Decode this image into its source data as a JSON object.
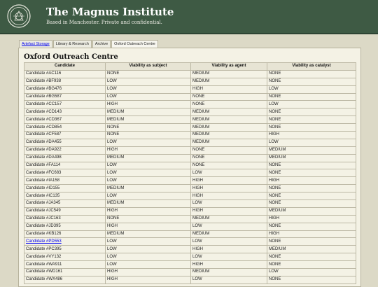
{
  "header": {
    "title": "The Magnus Institute",
    "tagline": "Based in Manchester. Private and confidential."
  },
  "tabs": [
    {
      "label": "Artefact Storage",
      "link": true
    },
    {
      "label": "Library & Research",
      "link": false
    },
    {
      "label": "Archive",
      "link": false
    },
    {
      "label": "Oxford Outreach Centre",
      "link": false,
      "active": true
    }
  ],
  "page": {
    "title": "Oxford Outreach Centre"
  },
  "table": {
    "columns": [
      "Candidate",
      "Viability as subject",
      "Viability as agent",
      "Viability as catalyst"
    ],
    "rows": [
      [
        "Candidate #AC116",
        "NONE",
        "MEDIUM",
        "NONE"
      ],
      [
        "Candidate #BF938",
        "LOW",
        "MEDIUM",
        "NONE"
      ],
      [
        "Candidate #BG476",
        "LOW",
        "HIGH",
        "LOW"
      ],
      [
        "Candidate #BG587",
        "LOW",
        "NONE",
        "NONE"
      ],
      [
        "Candidate #CC157",
        "HIGH",
        "NONE",
        "LOW"
      ],
      [
        "Candidate #CD143",
        "MEDIUM",
        "MEDIUM",
        "NONE"
      ],
      [
        "Candidate #CD367",
        "MEDIUM",
        "MEDIUM",
        "NONE"
      ],
      [
        "Candidate #CD854",
        "NONE",
        "MEDIUM",
        "NONE"
      ],
      [
        "Candidate #CF587",
        "NONE",
        "MEDIUM",
        "HIGH"
      ],
      [
        "Candidate #DA455",
        "LOW",
        "MEDIUM",
        "LOW"
      ],
      [
        "Candidate #DA922",
        "HIGH",
        "NONE",
        "MEDIUM"
      ],
      [
        "Candidate #DA498",
        "MEDIUM",
        "NONE",
        "MEDIUM"
      ],
      [
        "Candidate #FA114",
        "LOW",
        "NONE",
        "NONE"
      ],
      [
        "Candidate #FC683",
        "LOW",
        "LOW",
        "NONE"
      ],
      [
        "Candidate #IA158",
        "LOW",
        "HIGH",
        "HIGH"
      ],
      [
        "Candidate #ID155",
        "MEDIUM",
        "HIGH",
        "NONE"
      ],
      [
        "Candidate #IC135",
        "LOW",
        "HIGH",
        "NONE"
      ],
      [
        "Candidate #JA345",
        "MEDIUM",
        "LOW",
        "NONE"
      ],
      [
        "Candidate #JC549",
        "HIGH",
        "HIGH",
        "MEDIUM"
      ],
      [
        "Candidate #JC163",
        "NONE",
        "MEDIUM",
        "HIGH"
      ],
      [
        "Candidate #JD395",
        "HIGH",
        "LOW",
        "NONE"
      ],
      [
        "Candidate #KB126",
        "MEDIUM",
        "MEDIUM",
        "HIGH"
      ],
      [
        "Candidate #PD553",
        "LOW",
        "LOW",
        "NONE"
      ],
      [
        "Candidate #PC395",
        "LOW",
        "HIGH",
        "MEDIUM"
      ],
      [
        "Candidate #VY132",
        "LOW",
        "LOW",
        "NONE"
      ],
      [
        "Candidate #WA911",
        "LOW",
        "HIGH",
        "NONE"
      ],
      [
        "Candidate #WD161",
        "HIGH",
        "MEDIUM",
        "LOW"
      ],
      [
        "Candidate #WX486",
        "HIGH",
        "LOW",
        "NONE"
      ]
    ],
    "linked_row": "Candidate #PD553"
  },
  "colors": {
    "header_bg": "#3e5a44",
    "page_bg": "#dcd9c6",
    "panel_bg": "#f4f2e5",
    "link": "#0000ee"
  },
  "icons": {
    "logo": "institute-seal-icon"
  }
}
